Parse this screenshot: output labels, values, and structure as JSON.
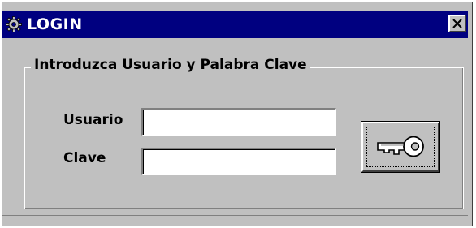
{
  "window": {
    "title": "LOGIN",
    "app_icon": "gear-icon",
    "close_icon": "close-icon"
  },
  "form": {
    "group_title": "Introduzca Usuario y Palabra Clave",
    "usuario_label": "Usuario",
    "usuario_value": "",
    "clave_label": "Clave",
    "clave_value": "",
    "submit_icon": "key-icon"
  },
  "colors": {
    "titlebar": "#000080",
    "face": "#c0c0c0"
  }
}
